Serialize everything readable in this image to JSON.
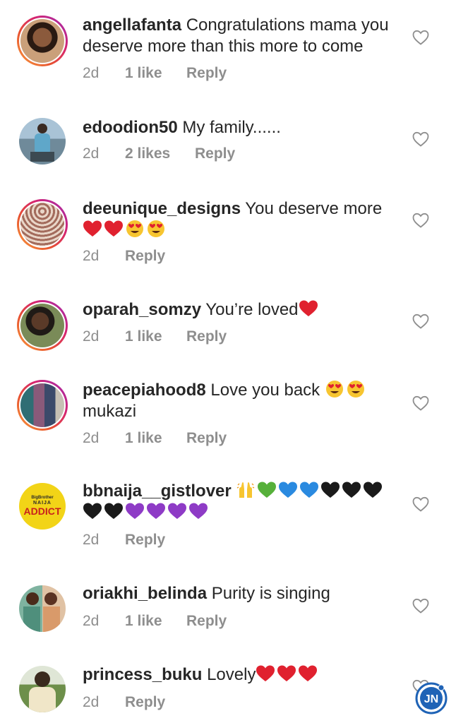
{
  "comments": [
    {
      "username": "angellafanta",
      "text": "Congratulations mama you deserve more than this more to come",
      "time": "2d",
      "likes": "1 like",
      "reply": "Reply",
      "avatar_colors": [
        "#caa07a",
        "#3a2418"
      ],
      "story": true
    },
    {
      "username": "edoodion50",
      "text": "My family......",
      "time": "2d",
      "likes": "2 likes",
      "reply": "Reply",
      "avatar_colors": [
        "#9bb4c7",
        "#3c4a52"
      ],
      "story": false
    },
    {
      "username": "deeunique_designs",
      "text": "You deserve more",
      "time": "2d",
      "likes": "",
      "reply": "Reply",
      "avatar_colors": [
        "#a36b5c",
        "#e9d6c8"
      ],
      "story": true
    },
    {
      "username": "oparah_somzy",
      "text": "You’re loved",
      "time": "2d",
      "likes": "1 like",
      "reply": "Reply",
      "avatar_colors": [
        "#7a8b58",
        "#2b2a24"
      ],
      "story": true
    },
    {
      "username": "peacepiahood8",
      "text": "Love you back",
      "text2": "mukazi",
      "time": "2d",
      "likes": "1 like",
      "reply": "Reply",
      "avatar_colors": [
        "#2f6e74",
        "#8a5a7a"
      ],
      "story": true
    },
    {
      "username": "bbnaija__gistlover",
      "text": "",
      "time": "2d",
      "likes": "",
      "reply": "Reply",
      "avatar_colors": [
        "#f2d417",
        "#c8201e"
      ],
      "story": false,
      "avatar_text_top": "BigBrother",
      "avatar_text_mid": "NAIJA",
      "avatar_text_bottom": "ADDICT"
    },
    {
      "username": "oriakhi_belinda",
      "text": "Purity is singing",
      "time": "2d",
      "likes": "1 like",
      "reply": "Reply",
      "avatar_colors": [
        "#4f8f7c",
        "#d99a6a"
      ],
      "story": false
    },
    {
      "username": "princess_buku",
      "text": "Lovely",
      "time": "2d",
      "likes": "",
      "reply": "Reply",
      "avatar_colors": [
        "#6d8f4a",
        "#2a2a1e"
      ],
      "story": false
    }
  ],
  "watermark": {
    "label": "JN",
    "color": "#1f63b6"
  },
  "colors": {
    "red_heart": "#e0212f",
    "green_heart": "#56b03a",
    "blue_heart": "#2a8ae0",
    "black_heart": "#1a1a1a",
    "purple_heart": "#8e3bc6",
    "emoji_face": "#f7c530"
  }
}
